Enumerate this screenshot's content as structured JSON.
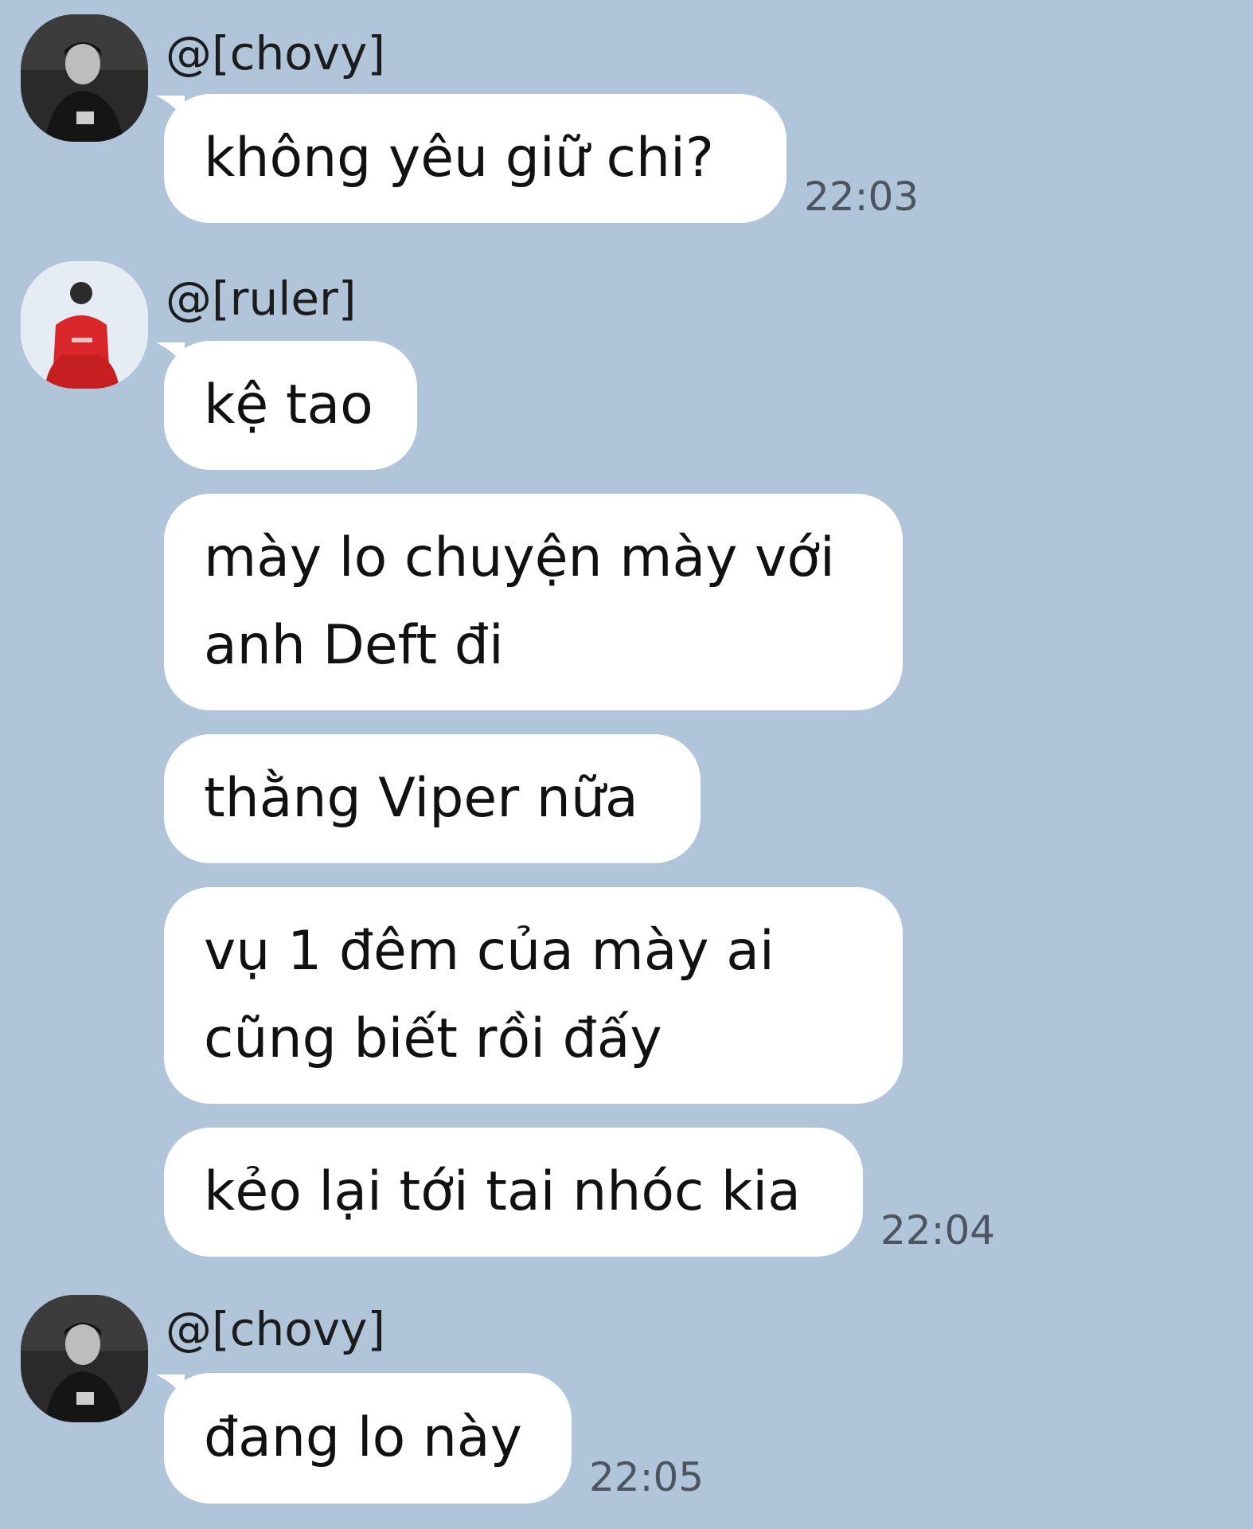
{
  "chat": {
    "messages": [
      {
        "sender": "@[chovy]",
        "text": "không yêu giữ chi?",
        "time": "22:03"
      },
      {
        "sender": "@[ruler]",
        "text": "kệ tao"
      },
      {
        "text": "mày lo chuyện mày với anh Deft đi"
      },
      {
        "text": "thằng Viper nữa"
      },
      {
        "text": "vụ 1 đêm của mày ai cũng biết rồi đấy"
      },
      {
        "text": "kẻo lại tới tai nhóc kia",
        "time": "22:04"
      },
      {
        "sender": "@[chovy]",
        "text": "đang lo này",
        "time": "22:05"
      }
    ]
  },
  "colors": {
    "background": "#b0c5da",
    "bubble": "#ffffff",
    "text": "#111111",
    "timestamp": "#4b5560"
  },
  "icons": [
    "avatar-chovy",
    "avatar-ruler"
  ]
}
